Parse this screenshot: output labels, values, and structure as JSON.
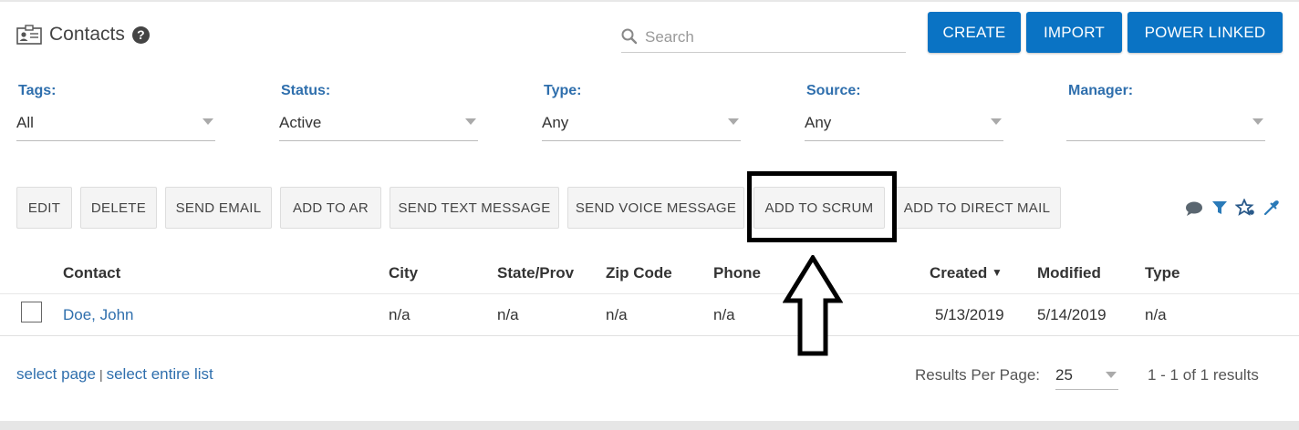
{
  "header": {
    "title": "Contacts",
    "title_icon": "contact-card-icon",
    "help_glyph": "?",
    "search_placeholder": "Search",
    "buttons": {
      "create": "CREATE",
      "import": "IMPORT",
      "power_linked": "POWER LINKED"
    }
  },
  "filters": [
    {
      "label": "Tags:",
      "value": "All"
    },
    {
      "label": "Status:",
      "value": "Active"
    },
    {
      "label": "Type:",
      "value": "Any"
    },
    {
      "label": "Source:",
      "value": "Any"
    },
    {
      "label": "Manager:",
      "value": ""
    }
  ],
  "actions": {
    "edit": "EDIT",
    "delete": "DELETE",
    "send_email": "SEND EMAIL",
    "add_to_ar": "ADD TO AR",
    "send_text": "SEND TEXT MESSAGE",
    "send_voice": "SEND VOICE MESSAGE",
    "add_to_scrum": "ADD TO SCRUM",
    "add_to_direct_mail": "ADD TO DIRECT MAIL"
  },
  "tool_icons": [
    "comment-icon",
    "filter-icon",
    "star-icon",
    "eyedropper-icon"
  ],
  "table": {
    "columns": {
      "contact": "Contact",
      "city": "City",
      "state": "State/Prov",
      "zip": "Zip Code",
      "phone": "Phone",
      "created": "Created",
      "created_sort": "▼",
      "modified": "Modified",
      "type": "Type"
    },
    "rows": [
      {
        "contact": "Doe, John",
        "city": "n/a",
        "state": "n/a",
        "zip": "n/a",
        "phone": "n/a",
        "created": "5/13/2019",
        "modified": "5/14/2019",
        "type": "n/a"
      }
    ]
  },
  "footer": {
    "select_page": "select page",
    "separator": "|",
    "select_list": "select entire list",
    "rpp_label": "Results Per Page:",
    "rpp_value": "25",
    "results": "1 - 1 of 1 results"
  },
  "colors": {
    "primary_button": "#0a73c4",
    "label_blue": "#2f6fad",
    "link_blue": "#2f6fad"
  }
}
